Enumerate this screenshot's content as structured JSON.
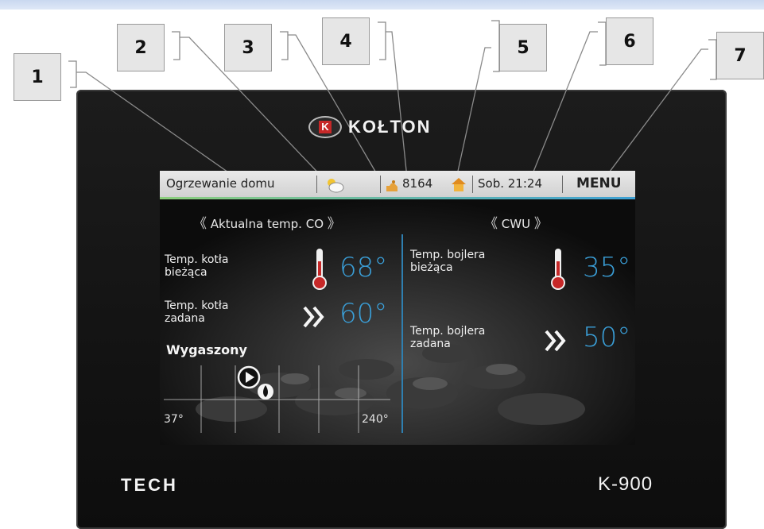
{
  "callouts": [
    "1",
    "2",
    "3",
    "4",
    "5",
    "6",
    "7"
  ],
  "brand": {
    "logo_letter": "K",
    "name": "KOŁTON"
  },
  "status_bar": {
    "mode": "Ogrzewanie domu",
    "weather_icon": "cloudy-sun-icon",
    "fuel_icon": "fuel-hand-icon",
    "fuel_level": "8164",
    "house_icon": "house-icon",
    "datetime": "Sob. 21:24",
    "menu_label": "MENU"
  },
  "left_panel": {
    "selector_label": "Aktualna temp. CO",
    "current_label_1": "Temp. kotła",
    "current_label_2": "bieżąca",
    "current_value": "68°",
    "set_label_1": "Temp. kotła",
    "set_label_2": "zadana",
    "set_value": "60°",
    "state": "Wygaszony",
    "scale_min": "37°",
    "scale_max": "240°"
  },
  "right_panel": {
    "selector_label": "CWU",
    "current_label_1": "Temp. bojlera",
    "current_label_2": "bieżąca",
    "current_value": "35°",
    "set_label_1": "Temp. bojlera",
    "set_label_2": "zadana",
    "set_value": "50°"
  },
  "device": {
    "maker": "TECH",
    "model": "K-900"
  },
  "colors": {
    "accent": "#3a9fd8",
    "status_gradient_start": "#8ccf7c",
    "status_gradient_end": "#3da0d4"
  }
}
